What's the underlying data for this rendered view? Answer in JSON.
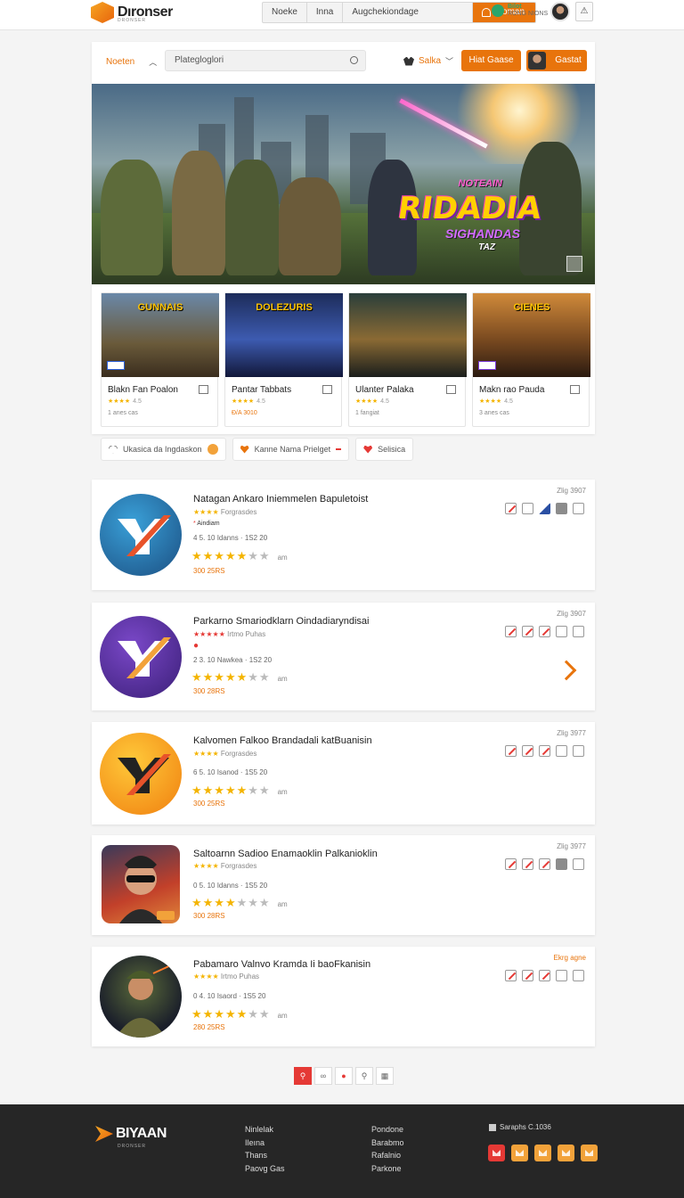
{
  "header": {
    "logo_text": "Dıronser",
    "logo_sub": "DRONSER",
    "nav": [
      {
        "label": "Noeke"
      },
      {
        "label": "Inna"
      },
      {
        "label": "Augchekiondage"
      }
    ],
    "nav_active_label": "Soman",
    "user_line1": "Bilot",
    "user_line2": "RONG NIONS"
  },
  "toolbar": {
    "filter_label": "Noeten",
    "search_placeholder": "Plategloglori",
    "sort_label": "Salka",
    "button1_label": "Hiat Gaase",
    "button2_label": "Gastat"
  },
  "hero": {
    "title": "RIDADIA",
    "tagline": "NOTEAIN",
    "subtitle": "SIGHANDAS",
    "small": "TAZ"
  },
  "featured": [
    {
      "art_title": "GUNNAIS",
      "name": "Blakn Fan Poalon",
      "rating": "★★★★",
      "score": "4.5",
      "meta": "1 anes cas"
    },
    {
      "art_title": "DOLEZURIS",
      "name": "Pantar Tabbats",
      "rating": "★★★★",
      "score": "4.5",
      "meta": "Đ/A 3010"
    },
    {
      "art_title": "",
      "name": "Ulanter Palaka",
      "rating": "★★★★",
      "score": "4.5",
      "meta": "1 fangiat"
    },
    {
      "art_title": "CIENES",
      "name": "Makn rao Pauda",
      "rating": "★★★★",
      "score": "4.5",
      "meta": "3 anes cas"
    }
  ],
  "chips": [
    {
      "label": "Ukasica da Ingdaskon"
    },
    {
      "label": "Kanne Nama Prielget"
    },
    {
      "label": "Selisica"
    }
  ],
  "items": [
    {
      "title": "Natagan Ankaro Iniemmelen Bapuletoist",
      "stars": "★★★★",
      "sub": "Forgrasdes",
      "tag": "Aindiam",
      "stats": "4  5.  10  Idanns · 1S2 20",
      "big": "★★★★★",
      "big_off": "★★",
      "big_note": "am",
      "price": "300 25RS",
      "date": "Zlig 3907"
    },
    {
      "title": "Parkarno Smariodklarn Oindadiaryndisai",
      "stars": "★★★★★",
      "sub": "Irtmo Puhas",
      "tag": "",
      "stats": "2  3.  10  Nawkea · 1S2 20",
      "big": "★★★★★",
      "big_off": "★★",
      "big_note": "am",
      "price": "300 28RS",
      "date": "Zlig 3907"
    },
    {
      "title": "Kalvomen Falkoo Brandadali katBuanisin",
      "stars": "★★★★",
      "sub": "Forgrasdes",
      "tag": "",
      "stats": "6  5.  10  Isanod · 1S5 20",
      "big": "★★★★★",
      "big_off": "★★",
      "big_note": "am",
      "price": "300 25RS",
      "date": "Zlig 3977"
    },
    {
      "title": "Saltoarnn Sadioo Enamaoklin Palkanioklin",
      "stars": "★★★★",
      "sub": "Forgrasdes",
      "tag": "",
      "stats": "0  5.  10  Idanns · 1S5 20",
      "big": "★★★★",
      "big_off": "★★★",
      "big_note": "am",
      "price": "300 28RS",
      "date": "Zlig 3977"
    },
    {
      "title": "Pabamaro Valnvo Kramda Ii baoFkanisin",
      "stars": "★★★★",
      "sub": "Irtmo Puhas",
      "tag": "",
      "stats": "0  4.  10  Isaord · 1S5 20",
      "big": "★★★★★",
      "big_off": "★★",
      "big_note": "am",
      "price": "280 25RS",
      "date": "Ekrg agne"
    }
  ],
  "footer": {
    "logo_text": "BIYAAN",
    "logo_sub": "DRONSER",
    "col1": [
      "Ninlelak",
      "Ileına",
      "Thans",
      "Paovg Gas"
    ],
    "col2": [
      "Pondone",
      "Barabmo",
      "Rafalnio",
      "Parkone"
    ],
    "contact": "Saraphs C.1036"
  },
  "colors": {
    "accent": "#e8740c",
    "star": "#f4b400",
    "footer_bg": "#262626"
  }
}
